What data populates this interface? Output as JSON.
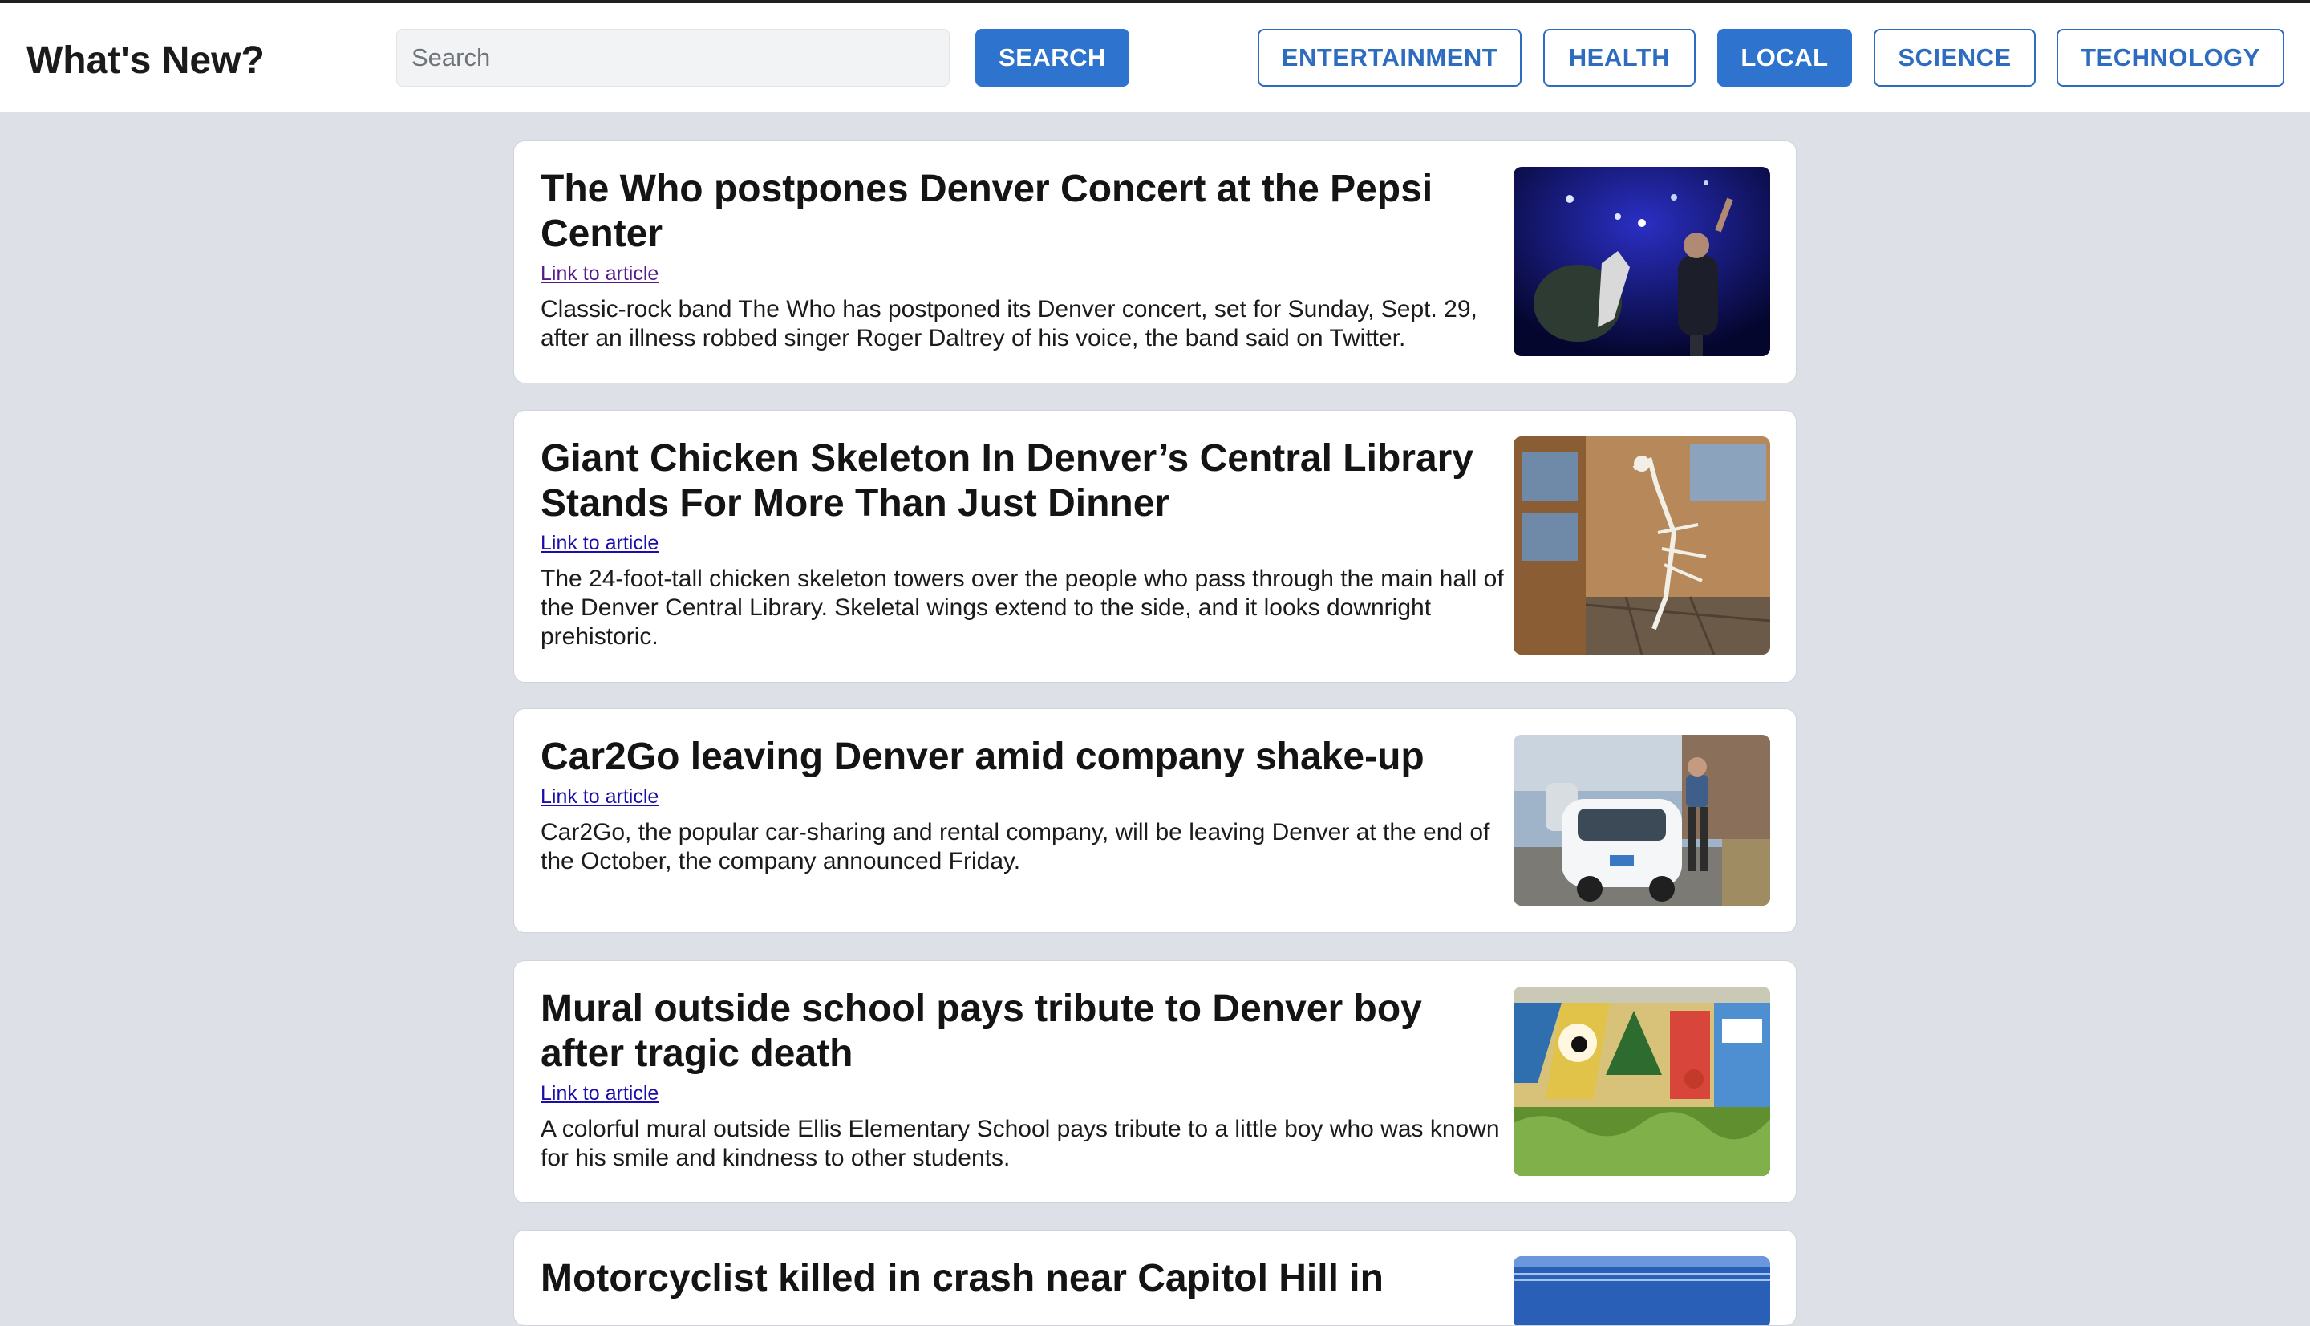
{
  "header": {
    "title": "What's New?",
    "search": {
      "placeholder": "Search",
      "value": ""
    },
    "search_button": "SEARCH",
    "categories": [
      {
        "label": "ENTERTAINMENT",
        "active": false
      },
      {
        "label": "HEALTH",
        "active": false
      },
      {
        "label": "LOCAL",
        "active": true
      },
      {
        "label": "SCIENCE",
        "active": false
      },
      {
        "label": "TECHNOLOGY",
        "active": false
      }
    ]
  },
  "colors": {
    "accent": "#2e74cf",
    "background": "#dde1e7",
    "link": "#1a0dab",
    "visited_link": "#551a8b"
  },
  "articles": [
    {
      "title": "The Who postpones Denver Concert at the Pepsi Center",
      "link_label": "Link to article",
      "visited": true,
      "description": "Classic-rock band The Who has postponed its Denver concert, set for Sunday, Sept. 29, after an illness robbed singer Roger Daltrey of his voice, the band said on Twitter.",
      "image_icon": "concert-stage-photo"
    },
    {
      "title": "Giant Chicken Skeleton In Denver’s Central Library Stands For More Than Just Dinner",
      "link_label": "Link to article",
      "visited": false,
      "description": "The 24-foot-tall chicken skeleton towers over the people who pass through the main hall of the Denver Central Library. Skeletal wings extend to the side, and it looks downright prehistoric.",
      "image_icon": "library-skeleton-photo"
    },
    {
      "title": "Car2Go leaving Denver amid company shake-up",
      "link_label": "Link to article",
      "visited": false,
      "description": "Car2Go, the popular car-sharing and rental company, will be leaving Denver at the end of the October, the company announced Friday.",
      "image_icon": "smart-car-photo"
    },
    {
      "title": "Mural outside school pays tribute to Denver boy after tragic death",
      "link_label": "Link to article",
      "visited": false,
      "description": "A colorful mural outside Ellis Elementary School pays tribute to a little boy who was known for his smile and kindness to other students.",
      "image_icon": "mural-photo"
    },
    {
      "title": "Motorcyclist killed in crash near Capitol Hill in",
      "link_label": "",
      "visited": false,
      "description": "",
      "image_icon": "news-photo"
    }
  ]
}
